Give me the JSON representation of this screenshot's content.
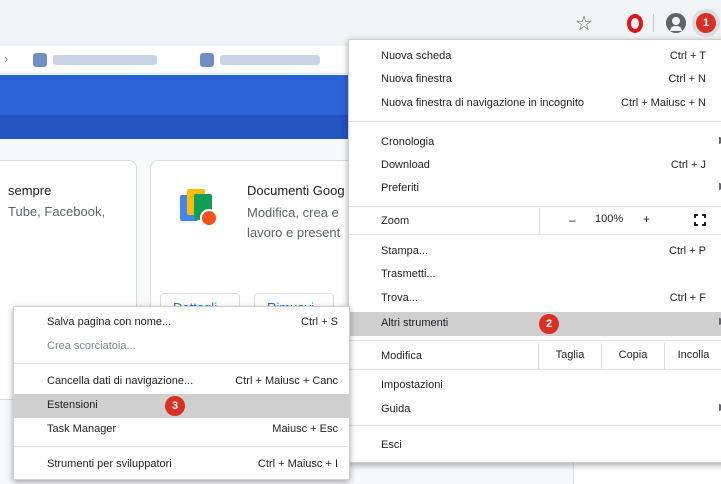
{
  "toolbar": {
    "icons": [
      "star-icon",
      "opera-icon",
      "profile-icon",
      "chrome-menu-icon"
    ],
    "menu_badge": "1"
  },
  "page": {
    "card1": {
      "title": "sempre",
      "text": "Tube, Facebook,"
    },
    "card2": {
      "title": "Documenti Goog",
      "text_line1": "Modifica, crea e",
      "text_line2": "lavoro e present"
    },
    "buttons": [
      "Dettagli",
      "Rimuovi"
    ]
  },
  "menu": {
    "new_tab": {
      "label": "Nuova scheda",
      "shortcut": "Ctrl + T"
    },
    "new_window": {
      "label": "Nuova finestra",
      "shortcut": "Ctrl + N"
    },
    "incognito": {
      "label": "Nuova finestra di navigazione in incognito",
      "shortcut": "Ctrl + Maiusc + N"
    },
    "history": {
      "label": "Cronologia"
    },
    "downloads": {
      "label": "Download",
      "shortcut": "Ctrl + J"
    },
    "bookmarks": {
      "label": "Preferiti"
    },
    "zoom": {
      "label": "Zoom",
      "minus": "–",
      "value": "100%",
      "plus": "+"
    },
    "print": {
      "label": "Stampa...",
      "shortcut": "Ctrl + P"
    },
    "cast": {
      "label": "Trasmetti..."
    },
    "find": {
      "label": "Trova...",
      "shortcut": "Ctrl + F"
    },
    "more_tools": {
      "label": "Altri strumenti",
      "badge": "2"
    },
    "edit": {
      "label": "Modifica",
      "cut": "Taglia",
      "copy": "Copia",
      "paste": "Incolla"
    },
    "settings": {
      "label": "Impostazioni"
    },
    "help": {
      "label": "Guida"
    },
    "exit": {
      "label": "Esci"
    }
  },
  "submenu": {
    "save_page": {
      "label": "Salva pagina con nome...",
      "shortcut": "Ctrl + S"
    },
    "create_shortcut": {
      "label": "Crea scorciatoia..."
    },
    "clear_data": {
      "label": "Cancella dati di navigazione...",
      "shortcut": "Ctrl + Maiusc + Canc"
    },
    "extensions": {
      "label": "Estensioni",
      "badge": "3"
    },
    "task_manager": {
      "label": "Task Manager",
      "shortcut": "Maiusc + Esc"
    },
    "dev_tools": {
      "label": "Strumenti per sviluppatori",
      "shortcut": "Ctrl + Maiusc + I"
    }
  },
  "colors": {
    "highlight": "#cfcfcf",
    "badge": "#d93025",
    "banner": "#2b63d6",
    "toolbar": "#f1f3f4"
  }
}
